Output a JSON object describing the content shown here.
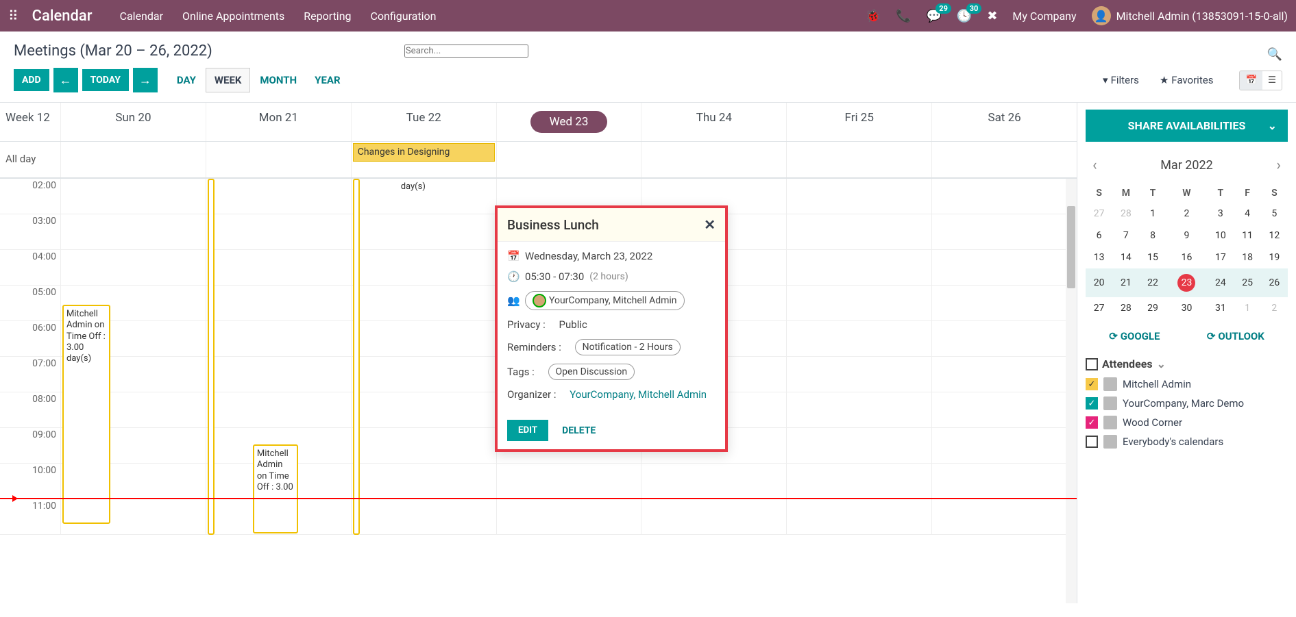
{
  "topnav": {
    "brand": "Calendar",
    "menu": [
      "Calendar",
      "Online Appointments",
      "Reporting",
      "Configuration"
    ],
    "msg_badge": "29",
    "activity_badge": "30",
    "company": "My Company",
    "user": "Mitchell Admin (13853091-15-0-all)"
  },
  "subheader": {
    "title": "Meetings (Mar 20 – 26, 2022)",
    "search_placeholder": "Search..."
  },
  "toolbar": {
    "add": "ADD",
    "today": "TODAY",
    "views": [
      "DAY",
      "WEEK",
      "MONTH",
      "YEAR"
    ],
    "active_view": "WEEK",
    "filters": "Filters",
    "favorites": "Favorites"
  },
  "dayheader": {
    "week": "Week 12",
    "days": [
      "Sun 20",
      "Mon 21",
      "Tue 22",
      "Wed 23",
      "Thu 24",
      "Fri 25",
      "Sat 26"
    ],
    "today_index": 3
  },
  "allday": {
    "label": "All day",
    "events": {
      "2": "Changes in Designing"
    }
  },
  "hours": [
    "02:00",
    "03:00",
    "04:00",
    "05:00",
    "06:00",
    "07:00",
    "08:00",
    "09:00",
    "10:00",
    "11:00"
  ],
  "events": {
    "sun_timeoff": "Mitchell Admin on Time Off : 3.00 day(s)",
    "mon_timeoff": "Mitchell Admin on Time Off : 3.00",
    "tue_daytext": "day(s)",
    "wed_lunch": "Business Lunch"
  },
  "popover": {
    "title": "Business Lunch",
    "date": "Wednesday, March 23, 2022",
    "time": "05:30 - 07:30",
    "duration": "(2 hours)",
    "attendee": "YourCompany, Mitchell Admin",
    "privacy_label": "Privacy :",
    "privacy_value": "Public",
    "reminders_label": "Reminders :",
    "reminders_value": "Notification - 2 Hours",
    "tags_label": "Tags :",
    "tags_value": "Open Discussion",
    "organizer_label": "Organizer :",
    "organizer_value": "YourCompany, Mitchell Admin",
    "edit": "EDIT",
    "delete": "DELETE"
  },
  "sidebar": {
    "share": "SHARE AVAILABILITIES",
    "month": "Mar 2022",
    "dow": [
      "S",
      "M",
      "T",
      "W",
      "T",
      "F",
      "S"
    ],
    "weeks": [
      [
        {
          "d": "27",
          "o": true
        },
        {
          "d": "28",
          "o": true
        },
        {
          "d": "1"
        },
        {
          "d": "2"
        },
        {
          "d": "3"
        },
        {
          "d": "4"
        },
        {
          "d": "5"
        }
      ],
      [
        {
          "d": "6"
        },
        {
          "d": "7"
        },
        {
          "d": "8"
        },
        {
          "d": "9"
        },
        {
          "d": "10"
        },
        {
          "d": "11"
        },
        {
          "d": "12"
        }
      ],
      [
        {
          "d": "13"
        },
        {
          "d": "14"
        },
        {
          "d": "15"
        },
        {
          "d": "16"
        },
        {
          "d": "17"
        },
        {
          "d": "18"
        },
        {
          "d": "19"
        }
      ],
      [
        {
          "d": "20"
        },
        {
          "d": "21"
        },
        {
          "d": "22"
        },
        {
          "d": "23",
          "today": true
        },
        {
          "d": "24"
        },
        {
          "d": "25"
        },
        {
          "d": "26"
        }
      ],
      [
        {
          "d": "27"
        },
        {
          "d": "28"
        },
        {
          "d": "29"
        },
        {
          "d": "30"
        },
        {
          "d": "31"
        },
        {
          "d": "1",
          "o": true
        },
        {
          "d": "2",
          "o": true
        }
      ]
    ],
    "sync_google": "GOOGLE",
    "sync_outlook": "OUTLOOK",
    "attendees_label": "Attendees",
    "attendees": [
      {
        "name": "Mitchell Admin",
        "color": "yellow",
        "checked": true
      },
      {
        "name": "YourCompany, Marc Demo",
        "color": "teal",
        "checked": true
      },
      {
        "name": "Wood Corner",
        "color": "pink",
        "checked": true
      },
      {
        "name": "Everybody's calendars",
        "color": "",
        "checked": false
      }
    ]
  }
}
